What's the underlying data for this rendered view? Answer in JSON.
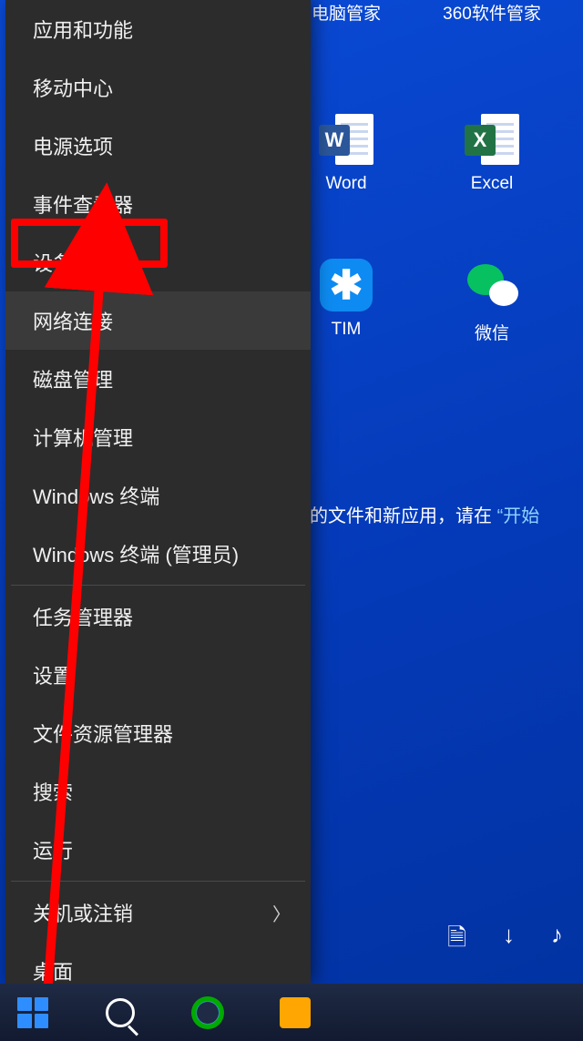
{
  "desktop": {
    "icons_row1": [
      {
        "label": "电脑管家"
      },
      {
        "label": "360软件管家"
      }
    ],
    "icons_row2": [
      {
        "label": "Word",
        "badge": "W"
      },
      {
        "label": "Excel",
        "badge": "X"
      }
    ],
    "icons_row3": [
      {
        "label": "TIM",
        "badge": "✱"
      },
      {
        "label": "微信"
      }
    ],
    "hint_prefix": "的文件和新应用，请在",
    "hint_link": "“开始"
  },
  "menu": {
    "items": [
      {
        "label": "应用和功能"
      },
      {
        "label": "移动中心"
      },
      {
        "label": "电源选项"
      },
      {
        "label": "事件查看器"
      },
      {
        "label": "设备管理器"
      },
      {
        "label": "网络连接"
      },
      {
        "label": "磁盘管理"
      },
      {
        "label": "计算机管理"
      },
      {
        "label": "Windows 终端"
      },
      {
        "label": "Windows 终端 (管理员)"
      },
      {
        "label": "任务管理器"
      },
      {
        "label": "设置"
      },
      {
        "label": "文件资源管理器"
      },
      {
        "label": "搜索"
      },
      {
        "label": "运行"
      },
      {
        "label": "关机或注销",
        "submenu": true
      },
      {
        "label": "桌面"
      }
    ]
  },
  "annotation": {
    "highlighted_item": "设备管理器"
  },
  "taskbar": {
    "start": "start-icon",
    "search": "search-icon",
    "settings": "settings-icon"
  },
  "tray": {
    "file": "🗎",
    "download": "↓",
    "music": "♪"
  }
}
